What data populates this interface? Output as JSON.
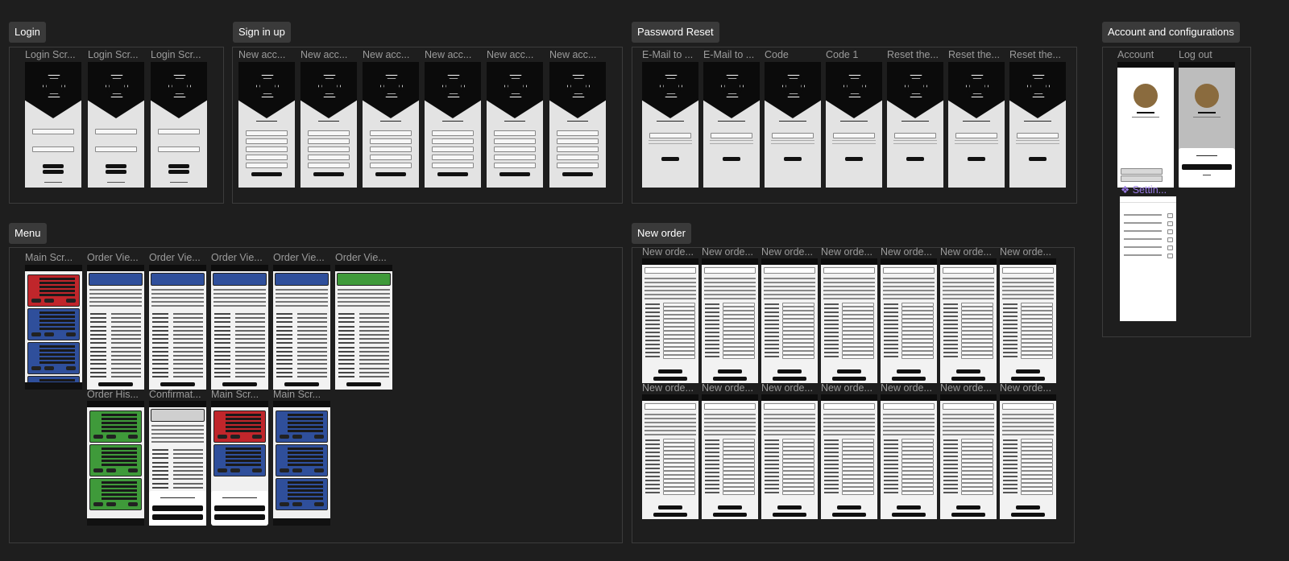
{
  "sections": [
    {
      "label": "Login"
    },
    {
      "label": "Sign in up"
    },
    {
      "label": "Password Reset"
    },
    {
      "label": "Account and configurations"
    },
    {
      "label": "Menu"
    },
    {
      "label": "New order"
    }
  ],
  "frames": {
    "login": [
      "Login Scr...",
      "Login Scr...",
      "Login Scr..."
    ],
    "signup": [
      "New acc...",
      "New acc...",
      "New acc...",
      "New acc...",
      "New acc...",
      "New acc..."
    ],
    "reset": [
      "E-Mail to ...",
      "E-Mail to ...",
      "Code",
      "Code 1",
      "Reset the...",
      "Reset the...",
      "Reset the..."
    ],
    "account": [
      "Account",
      "Log out"
    ],
    "menu_row1": [
      "Main Scr...",
      "Order Vie...",
      "Order Vie...",
      "Order Vie...",
      "Order Vie...",
      "Order Vie..."
    ],
    "menu_row2": [
      "Order His...",
      "Confirmat...",
      "Main Scr...",
      "Main Scr..."
    ],
    "neworder_row1": [
      "New orde...",
      "New orde...",
      "New orde...",
      "New orde...",
      "New orde...",
      "New orde...",
      "New orde..."
    ],
    "neworder_row2": [
      "New orde...",
      "New orde...",
      "New orde...",
      "New orde...",
      "New orde...",
      "New orde...",
      "New orde..."
    ],
    "settings": "Settin..."
  },
  "colors": {
    "canvas": "#1e1e1e",
    "section_label_bg": "#3a3a3a",
    "frame_title": "#9b9b9b",
    "phone_bg": "#e3e3e3",
    "header_black": "#0b0b0b",
    "card_red": "#c0262b",
    "card_blue": "#2f4f9b",
    "card_green": "#3f9a3a",
    "settings_purple": "#9b7be8"
  },
  "icons": {
    "settings_frame": "component-diamond-icon"
  }
}
